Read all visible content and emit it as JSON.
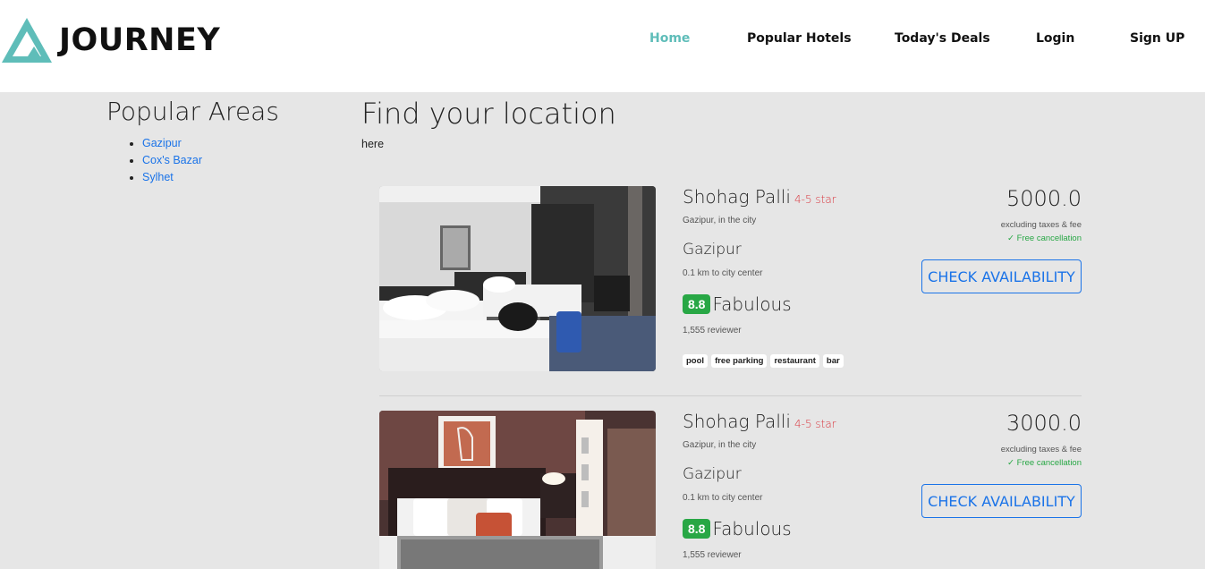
{
  "brand": {
    "name": "JOURNEY",
    "logo_color": "#5fbdb9"
  },
  "nav": {
    "items": [
      {
        "label": "Home",
        "active": true
      },
      {
        "label": "Popular Hotels"
      },
      {
        "label": "Today's Deals"
      },
      {
        "label": "Login"
      },
      {
        "label": "Sign UP"
      }
    ]
  },
  "sidebar": {
    "title": "Popular Areas",
    "areas": [
      "Gazipur",
      "Cox's Bazar",
      "Sylhet"
    ]
  },
  "main": {
    "title": "Find your location",
    "subtitle": "here"
  },
  "hotels": [
    {
      "name": "Shohag Palli",
      "star": "4-5 star",
      "location": "Gazipur, in the city",
      "city": "Gazipur",
      "distance": "0.1 km to city center",
      "score": "8.8",
      "rating": "Fabulous",
      "reviewers": "1,555 reviewer",
      "tags": [
        "pool",
        "free parking",
        "restaurant",
        "bar"
      ],
      "price": "5000.0",
      "price_note": "excluding taxes & fee",
      "cancellation": "✓ Free cancellation",
      "button": "CHECK AVAILABILITY"
    },
    {
      "name": "Shohag Palli",
      "star": "4-5 star",
      "location": "Gazipur, in the city",
      "city": "Gazipur",
      "distance": "0.1 km to city center",
      "score": "8.8",
      "rating": "Fabulous",
      "reviewers": "1,555 reviewer",
      "price": "3000.0",
      "price_note": "excluding taxes & fee",
      "cancellation": "✓ Free cancellation",
      "button": "CHECK AVAILABILITY"
    }
  ],
  "colors": {
    "accent": "#5fbdb9",
    "link": "#1a73e8",
    "rating": "#28a745",
    "star": "#d9363e"
  }
}
